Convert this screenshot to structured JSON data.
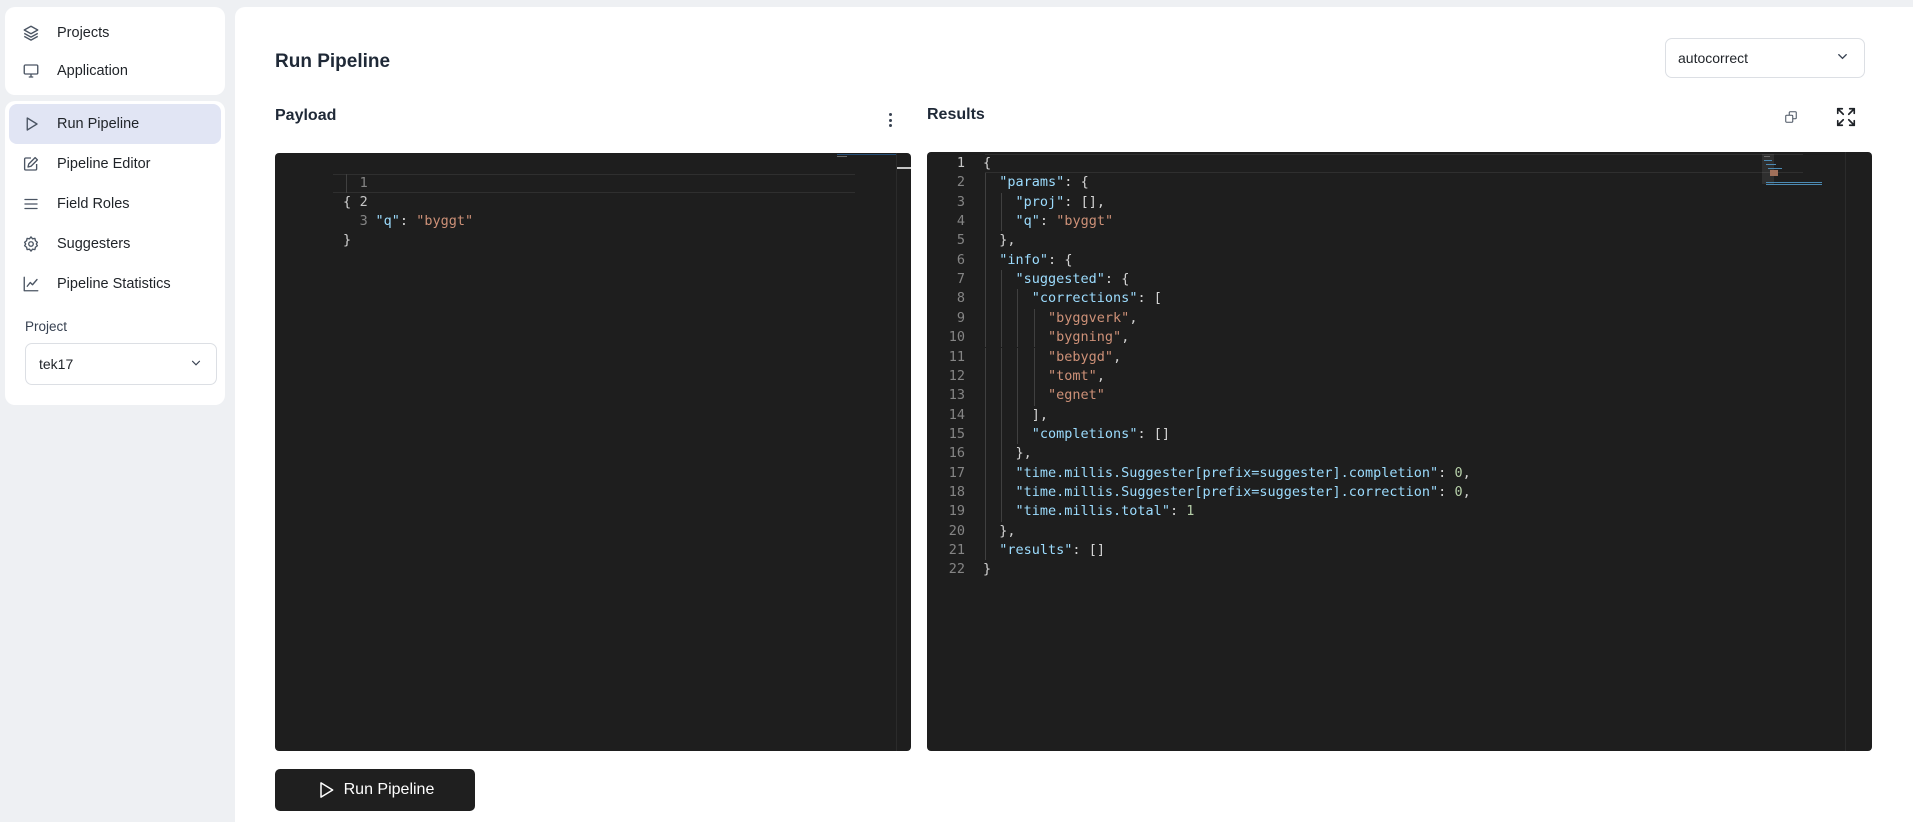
{
  "sidebar": {
    "top_items": [
      {
        "label": "Projects",
        "icon": "layers-icon"
      },
      {
        "label": "Application",
        "icon": "monitor-icon"
      }
    ],
    "items": [
      {
        "label": "Run Pipeline",
        "icon": "play-icon",
        "active": true
      },
      {
        "label": "Pipeline Editor",
        "icon": "edit-icon"
      },
      {
        "label": "Field Roles",
        "icon": "list-icon"
      },
      {
        "label": "Suggesters",
        "icon": "gear-icon"
      },
      {
        "label": "Pipeline Statistics",
        "icon": "chart-line-icon"
      }
    ],
    "project_label": "Project",
    "project_value": "tek17"
  },
  "main": {
    "title": "Run Pipeline",
    "pipeline_select": "autocorrect",
    "payload_label": "Payload",
    "results_label": "Results",
    "run_button": "Run Pipeline"
  },
  "payload_editor": {
    "current_line": 2,
    "lines": [
      "{",
      "    \"q\": \"byggt\"",
      "}"
    ]
  },
  "results_editor": {
    "current_line": 1,
    "lines": [
      "{",
      "  \"params\": {",
      "    \"proj\": [],",
      "    \"q\": \"byggt\"",
      "  },",
      "  \"info\": {",
      "    \"suggested\": {",
      "      \"corrections\": [",
      "        \"byggverk\",",
      "        \"bygning\",",
      "        \"bebygd\",",
      "        \"tomt\",",
      "        \"egnet\"",
      "      ],",
      "      \"completions\": []",
      "    },",
      "    \"time.millis.Suggester[prefix=suggester].completion\": 0,",
      "    \"time.millis.Suggester[prefix=suggester].correction\": 0,",
      "    \"time.millis.total\": 1",
      "  },",
      "  \"results\": []",
      "}"
    ]
  },
  "colors": {
    "accent_active": "#e1e5f4",
    "editor_bg": "#1e1e1e",
    "json_key": "#9cdcfe",
    "json_string": "#ce9178",
    "json_number": "#b5cea8",
    "button_bg": "#1f1f1f"
  }
}
